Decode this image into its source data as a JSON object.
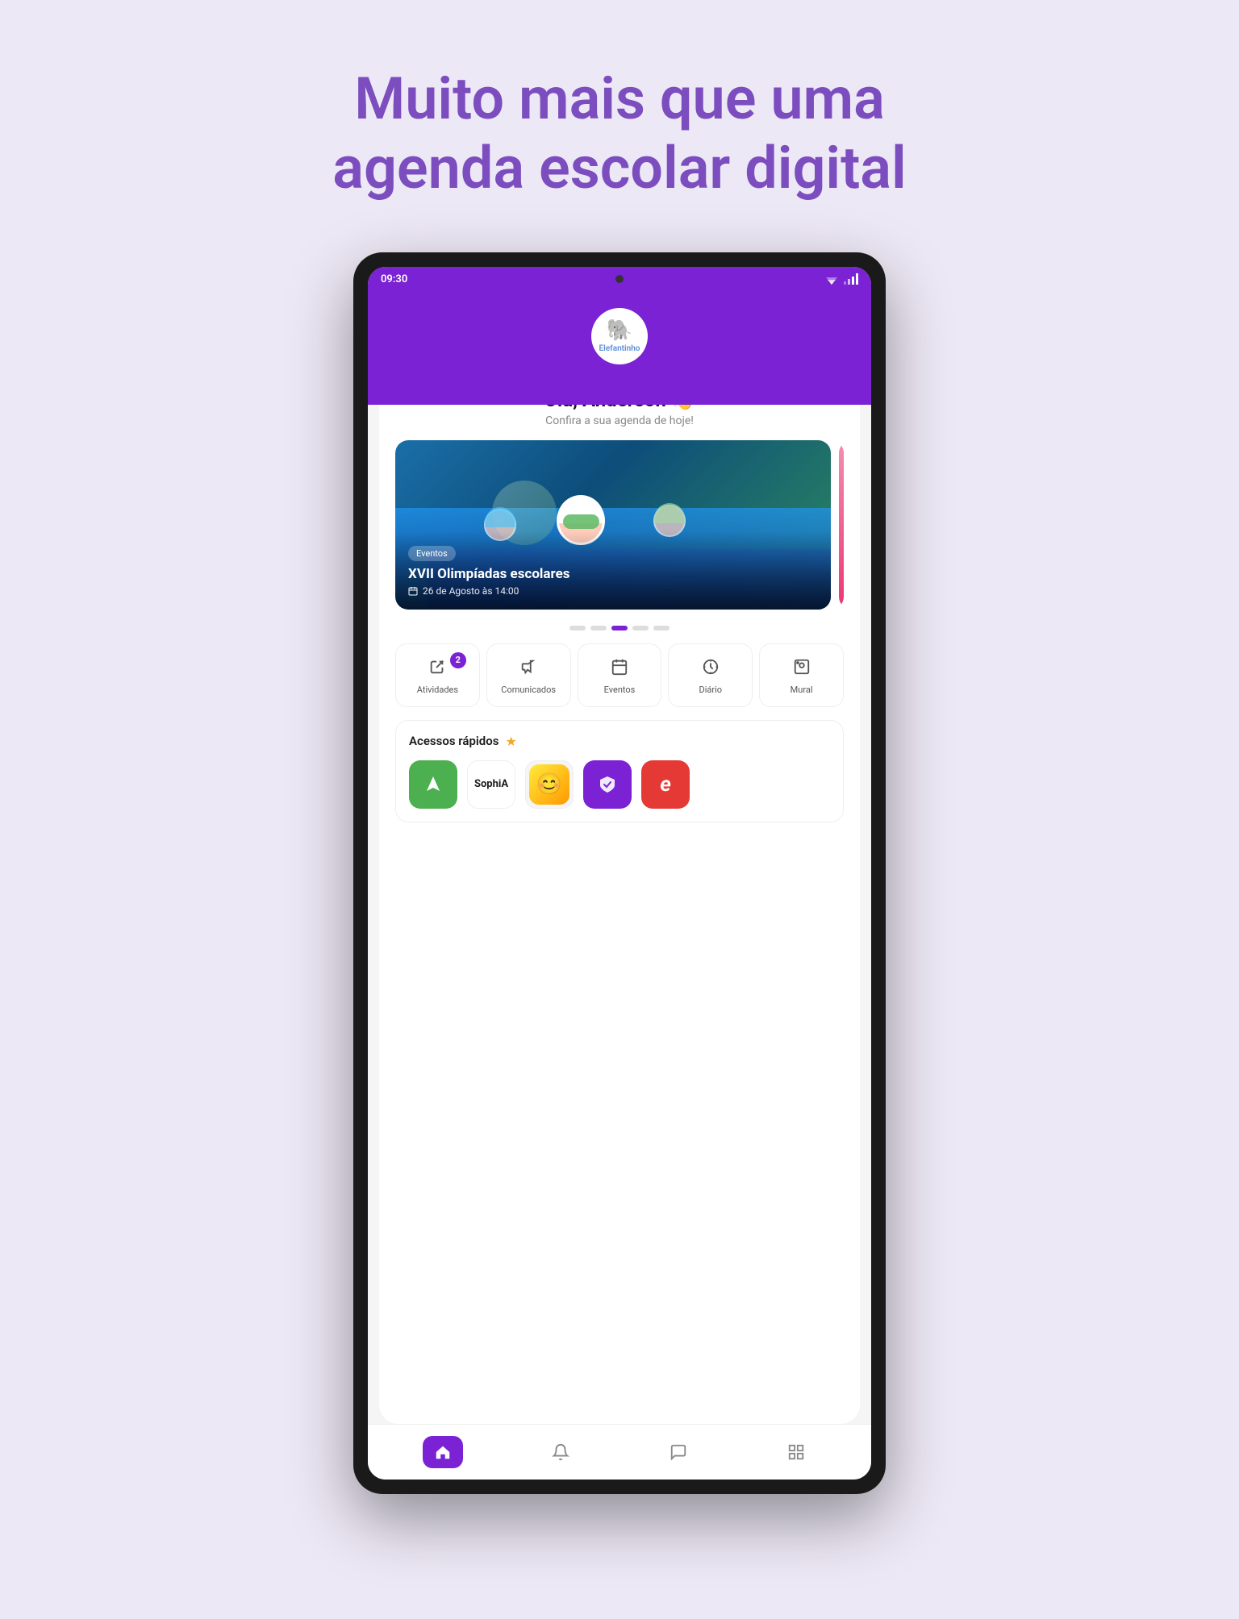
{
  "page": {
    "background_color": "#ede8f5",
    "title": "Muito mais que uma agenda escolar digital"
  },
  "status_bar": {
    "time": "09:30",
    "color": "#7b22d4"
  },
  "header": {
    "school_name": "Elefantinho",
    "greeting": "Olá, Anderson 👋",
    "greeting_sub": "Confira a sua agenda de hoje!",
    "wave_emoji": "👋"
  },
  "event_card": {
    "tag": "Eventos",
    "title": "XVII Olimpíadas escolares",
    "date": "26 de Agosto às 14:00"
  },
  "carousel_dots": [
    {
      "active": false
    },
    {
      "active": false
    },
    {
      "active": true
    },
    {
      "active": false
    },
    {
      "active": false
    }
  ],
  "quick_menu": [
    {
      "label": "Atividades",
      "badge": "2"
    },
    {
      "label": "Comunicados"
    },
    {
      "label": "Eventos"
    },
    {
      "label": "Diário"
    },
    {
      "label": "Mural"
    }
  ],
  "quick_access": {
    "title": "Acessos rápidos",
    "apps": [
      {
        "name": "Arco",
        "color": "green"
      },
      {
        "name": "SophiA",
        "color": "white"
      },
      {
        "name": "Avatar",
        "color": "avatar"
      },
      {
        "name": "Shield",
        "color": "purple"
      },
      {
        "name": "E",
        "color": "red"
      }
    ]
  },
  "bottom_nav": [
    {
      "name": "home",
      "active": true
    },
    {
      "name": "notifications"
    },
    {
      "name": "messages"
    },
    {
      "name": "grid"
    }
  ]
}
